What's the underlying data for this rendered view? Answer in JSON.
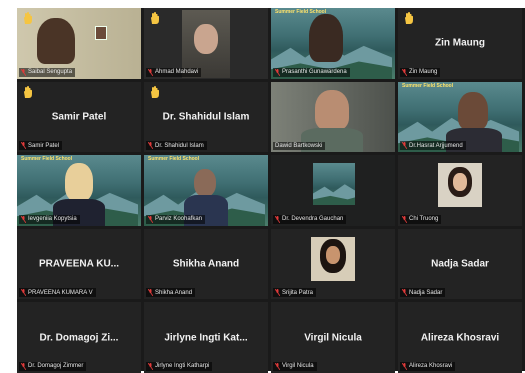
{
  "poster": {
    "title": "Summer Field School"
  },
  "colors": {
    "speaking_border": "#c8e05a",
    "muted_mic": "#e03a3a",
    "hand": "#f5c542",
    "tile_bg": "#232323"
  },
  "tiles": [
    {
      "name": "Saibal Sengupta",
      "label": "Saibal Sengupta",
      "hand": true,
      "mic_icon": "muted-mic-icon"
    },
    {
      "name": "Ahmad Mahdavi",
      "label": "Ahmad Mahdavi",
      "hand": true,
      "mic_icon": "muted-mic-icon"
    },
    {
      "name": "Prasanthi Gunawardena",
      "label": "Prasanthi Gunawardena",
      "hand": false,
      "mic_icon": "muted-mic-icon"
    },
    {
      "name": "Zin Maung",
      "label": "Zin Maung",
      "hand": true,
      "mic_icon": "muted-mic-icon"
    },
    {
      "name": "Samir Patel",
      "label": "Samir Patel",
      "hand": true,
      "mic_icon": "muted-mic-icon"
    },
    {
      "name": "Dr. Shahidul Islam",
      "label": "Dr. Shahidul Islam",
      "hand": true,
      "mic_icon": "muted-mic-icon"
    },
    {
      "name": "Dawid Bartkowski",
      "label": "Dawid Bartkowski",
      "hand": false,
      "speaking": true
    },
    {
      "name": "Dr.Hasrat Arjjumend",
      "label": "Dr.Hasrat Arjjumend",
      "hand": false,
      "mic_icon": "muted-mic-icon"
    },
    {
      "name": "Ievgeniia Kopytsia",
      "label": "Ievgeniia Kopytsia",
      "hand": false,
      "mic_icon": "muted-mic-icon"
    },
    {
      "name": "Parviz Koohafkan",
      "label": "Parviz Koohafkan",
      "hand": false,
      "mic_icon": "muted-mic-icon"
    },
    {
      "name": "Dr. Devendra Gauchan",
      "label": "Dr. Devendra Gauchan",
      "hand": false,
      "mic_icon": "muted-mic-icon"
    },
    {
      "name": "Chi Truong",
      "label": "Chi Truong",
      "hand": false,
      "mic_icon": "muted-mic-icon"
    },
    {
      "name": "PRAVEENA KU...",
      "label": "PRAVEENA KUMARA V",
      "hand": false,
      "mic_icon": "muted-mic-icon"
    },
    {
      "name": "Shikha Anand",
      "label": "Shikha Anand",
      "hand": false,
      "mic_icon": "muted-mic-icon"
    },
    {
      "name": "Srijita Patra",
      "label": "Srijita Patra",
      "hand": false,
      "mic_icon": "muted-mic-icon"
    },
    {
      "name": "Nadja Sadar",
      "label": "Nadja Sadar",
      "hand": false,
      "mic_icon": "muted-mic-icon"
    },
    {
      "name": "Dr. Domagoj Zi...",
      "label": "Dr. Domagoj Zimmer",
      "hand": false,
      "mic_icon": "muted-mic-icon"
    },
    {
      "name": "Jirlyne Ingti Kat...",
      "label": "Jirlyne Ingti Katharpi",
      "hand": false,
      "mic_icon": "muted-mic-icon"
    },
    {
      "name": "Virgil Nicula",
      "label": "Virgil Nicula",
      "hand": false,
      "mic_icon": "muted-mic-icon"
    },
    {
      "name": "Alireza Khosravi",
      "label": "Alireza Khosravi",
      "hand": false,
      "mic_icon": "muted-mic-icon"
    }
  ]
}
